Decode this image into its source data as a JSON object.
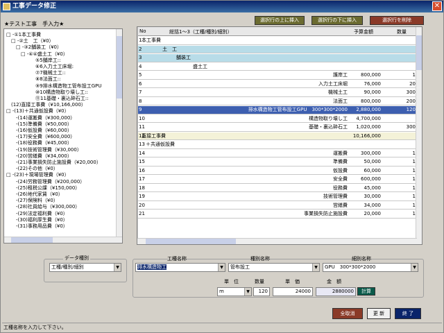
{
  "window": {
    "title": "工事データ修正"
  },
  "subtitle": "★テスト工事　手入力★",
  "tree": [
    "□ -①1本工事費",
    "　□ -②土　工（¥0）",
    "　　□ -③2舗装工（¥0）",
    "　　　□ -④④盛土工（¥0）",
    "　　　　　　⑤5舗岸工::",
    "　　　　　　⑥6入力土工床堀:",
    "　　　　　　⑦7機械土工::",
    "　　　　　　⑧8法面工::",
    "　　　　　　⑨9排水構造物工管布設工GPU",
    "　　　　　　⑩10構造物取り壊し工::",
    "　　　　　　⑪11基礎・裏込砕石工::",
    "　(12)直接工事費（¥10,166,000）",
    "□ -(13)＋共通仮設費（¥0）",
    "　　-(14)運搬費（¥300,000）",
    "　　-(15)準備費（¥50,000）",
    "　　-(16)仮設費（¥60,000）",
    "　　-(17)安全費（¥600,000）",
    "　　-(18)役務費（¥45,000）",
    "　　-(19)技術管理費（¥30,000）",
    "　　-(20)営繕費（¥34,000）",
    "　　-(21)事業損失防止施設費（¥20,000）",
    "　　-(22)その他（¥0）",
    "□ -(23)＋現場管理費（¥0）",
    "　　-(24)労務管理費（¥200,000）",
    "　　-(25)租税公課（¥150,000）",
    "　　-(26)地代家賃（¥0）",
    "　　-(27)保険料（¥0）",
    "　　-(28)社員給与（¥300,000）",
    "　　-(29)法定福利費（¥0）",
    "　　-(30)福利厚生費（¥0）",
    "　　-(31)事務用品費（¥0）"
  ],
  "buttons": {
    "insert_above": "選択行の上に挿入",
    "insert_below": "選択行の下に挿入",
    "delete_row": "選択行を削除",
    "cancel": "全取消",
    "update": "更 新",
    "finish": "終 了",
    "calc": "計算"
  },
  "grid": {
    "headers": {
      "no": "No",
      "name": "総括1～3（工種/種別/細別）",
      "amount": "予算金額",
      "qty": "数量"
    },
    "rows": [
      {
        "no": "1",
        "name": "本工事費",
        "amount": "",
        "qty": ""
      },
      {
        "no": "2",
        "name": "土　工",
        "amount": "",
        "qty": ""
      },
      {
        "no": "3",
        "name": "舗装工",
        "amount": "",
        "qty": ""
      },
      {
        "no": "4",
        "name": "盛土工",
        "amount": "",
        "qty": ""
      },
      {
        "no": "5",
        "name": "護岸工",
        "amount": "800,000",
        "qty": "1"
      },
      {
        "no": "6",
        "name": "入力土工床堀",
        "amount": "76,000",
        "qty": "20"
      },
      {
        "no": "7",
        "name": "機械土工",
        "amount": "90,000",
        "qty": "300"
      },
      {
        "no": "8",
        "name": "法面工",
        "amount": "800,000",
        "qty": "200"
      },
      {
        "no": "9",
        "name": "排水構造物工管布設工GPU　300*300*2000",
        "amount": "2,880,000",
        "qty": "120"
      },
      {
        "no": "10",
        "name": "構造物取り壊し工",
        "amount": "4,700,000",
        "qty": ""
      },
      {
        "no": "11",
        "name": "基礎・裏込砕石工",
        "amount": "1,020,000",
        "qty": "300"
      },
      {
        "no": "12",
        "name": "直接工事費",
        "amount": "10,166,000",
        "qty": ""
      },
      {
        "no": "13",
        "name": "＋共通仮設費",
        "amount": "",
        "qty": ""
      },
      {
        "no": "14",
        "name": "運搬費",
        "amount": "300,000",
        "qty": "1"
      },
      {
        "no": "15",
        "name": "準備費",
        "amount": "50,000",
        "qty": "1"
      },
      {
        "no": "16",
        "name": "仮設費",
        "amount": "60,000",
        "qty": "1"
      },
      {
        "no": "17",
        "name": "安全費",
        "amount": "600,000",
        "qty": "1"
      },
      {
        "no": "18",
        "name": "役務費",
        "amount": "45,000",
        "qty": "1"
      },
      {
        "no": "19",
        "name": "技術管理費",
        "amount": "30,000",
        "qty": "1"
      },
      {
        "no": "20",
        "name": "営繕費",
        "amount": "34,000",
        "qty": "1"
      },
      {
        "no": "21",
        "name": "事業損失防止施設費",
        "amount": "20,000",
        "qty": "1"
      }
    ]
  },
  "form": {
    "data_kind_label": "データ種別",
    "data_kind_value": "工種/種別/細別",
    "work_label": "工種名称",
    "work_value": "排水構造物工",
    "type_label": "種別名称",
    "type_value": "管布設工",
    "detail_label": "細別名称",
    "detail_value": "GPU　300*300*2000",
    "unit_label": "単　位",
    "unit_value": "m",
    "qty_label": "数量",
    "qty_value": "120",
    "price_label": "単　価",
    "price_value": "24000",
    "amount_label": "金　額",
    "amount_value": "2880000"
  },
  "status": "工種名称を入力して下さい。"
}
